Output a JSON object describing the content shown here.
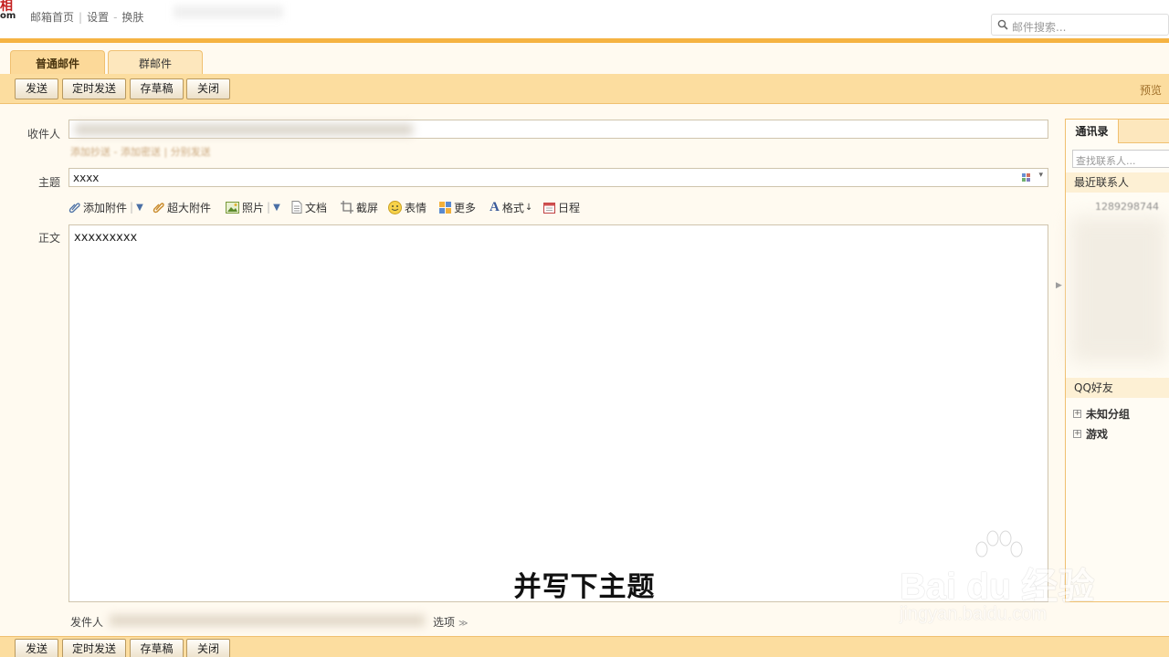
{
  "topbar": {
    "logo_line1": "相",
    "logo_line2": "om",
    "links": [
      "邮箱首页",
      "设置",
      "换肤"
    ],
    "search_placeholder": "邮件搜索..."
  },
  "tabs": [
    {
      "label": "普通邮件",
      "active": true
    },
    {
      "label": "群邮件",
      "active": false
    }
  ],
  "toolbar": {
    "send": "发送",
    "scheduled_send": "定时发送",
    "save_draft": "存草稿",
    "close": "关闭",
    "preview": "预览"
  },
  "compose": {
    "recipient_label": "收件人",
    "recipient_links": "添加抄送 - 添加密送 | 分别发送",
    "subject_label": "主题",
    "subject_value": "xxxx",
    "body_label": "正文",
    "body_value": "xxxxxxxxx",
    "sender_label": "发件人",
    "options_label": "选项"
  },
  "format_toolbar": {
    "add_attachment": "添加附件",
    "large_attachment": "超大附件",
    "photo": "照片",
    "document": "文档",
    "screenshot": "截屏",
    "emoji": "表情",
    "more": "更多",
    "format": "格式",
    "schedule": "日程"
  },
  "contacts_panel": {
    "tab_label": "通讯录",
    "search_placeholder": "查找联系人...",
    "recent_header": "最近联系人",
    "recent_contact": "1289298744",
    "qq_header": "QQ好友",
    "groups": [
      "未知分组",
      "游戏"
    ]
  },
  "overlay": {
    "subtitle": "并写下主题",
    "watermark_main": "Bai du 经验",
    "watermark_sub": "jingyan.baidu.com"
  },
  "colors": {
    "accent_orange": "#f5b342",
    "toolbar_bg": "#fcdd9f",
    "link_brown": "#a0702a"
  }
}
